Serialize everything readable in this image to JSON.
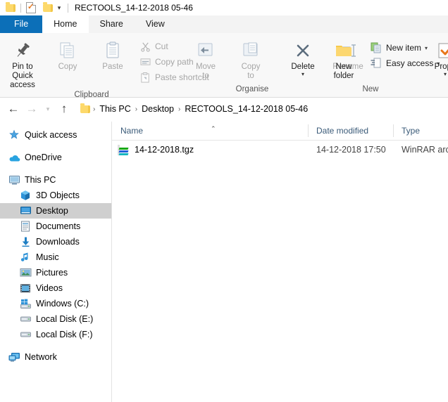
{
  "window": {
    "title": "RECTOOLS_14-12-2018 05-46",
    "quick_access_toolbar": [
      {
        "name": "folder-icon",
        "label": ""
      },
      {
        "name": "properties-icon",
        "label": ""
      },
      {
        "name": "new-folder-icon",
        "label": ""
      },
      {
        "name": "customize-qat-chevron-icon",
        "label": "▾"
      }
    ]
  },
  "tabs": [
    {
      "label": "File",
      "active": false,
      "is_file": true
    },
    {
      "label": "Home",
      "active": true,
      "is_file": false
    },
    {
      "label": "Share",
      "active": false,
      "is_file": false
    },
    {
      "label": "View",
      "active": false,
      "is_file": false
    }
  ],
  "ribbon": {
    "groups": [
      {
        "label": "Clipboard",
        "big_buttons": [
          {
            "label": "Pin to Quick\naccess",
            "icon": "pin-icon",
            "disabled": false
          },
          {
            "label": "Copy",
            "icon": "copy-icon",
            "disabled": true
          },
          {
            "label": "Paste",
            "icon": "paste-icon",
            "disabled": true
          }
        ],
        "small_buttons": [
          {
            "label": "Cut",
            "icon": "scissors-icon",
            "disabled": true
          },
          {
            "label": "Copy path",
            "icon": "copy-path-icon",
            "disabled": true
          },
          {
            "label": "Paste shortcut",
            "icon": "paste-shortcut-icon",
            "disabled": true
          }
        ]
      },
      {
        "label": "Organise",
        "big_buttons": [
          {
            "label": "Move\nto",
            "icon": "move-to-icon",
            "disabled": true,
            "caret": "▾"
          },
          {
            "label": "Copy\nto",
            "icon": "copy-to-icon",
            "disabled": true,
            "caret": "▾"
          },
          {
            "label": "Delete",
            "icon": "delete-x-icon",
            "disabled": false,
            "caret_below": "▾"
          },
          {
            "label": "Rename",
            "icon": "rename-icon",
            "disabled": true
          }
        ],
        "small_buttons": []
      },
      {
        "label": "New",
        "big_buttons": [
          {
            "label": "New\nfolder",
            "icon": "new-folder-icon",
            "disabled": false
          }
        ],
        "small_buttons": [
          {
            "label": "New item",
            "icon": "new-item-icon",
            "disabled": false,
            "caret": "▾"
          },
          {
            "label": "Easy access",
            "icon": "easy-access-icon",
            "disabled": false,
            "caret": "▾"
          }
        ]
      },
      {
        "label": "",
        "big_buttons": [
          {
            "label": "Prope",
            "icon": "properties-icon",
            "disabled": false,
            "caret_below": "▾"
          }
        ],
        "small_buttons": []
      }
    ]
  },
  "address_bar": {
    "back": "←",
    "forward": "→",
    "recent": "▾",
    "up": "↑",
    "breadcrumb": [
      "This PC",
      "Desktop",
      "RECTOOLS_14-12-2018 05-46"
    ],
    "separator": "›"
  },
  "sidebar": {
    "items": [
      {
        "label": "Quick access",
        "icon": "star-icon",
        "indent": false,
        "selected": false
      },
      {
        "label": "OneDrive",
        "icon": "cloud-icon",
        "indent": false,
        "selected": false,
        "gap_before": true
      },
      {
        "label": "This PC",
        "icon": "monitor-icon",
        "indent": false,
        "selected": false,
        "gap_before": true
      },
      {
        "label": "3D Objects",
        "icon": "3d-objects-icon",
        "indent": true,
        "selected": false
      },
      {
        "label": "Desktop",
        "icon": "desktop-icon",
        "indent": true,
        "selected": true
      },
      {
        "label": "Documents",
        "icon": "documents-icon",
        "indent": true,
        "selected": false
      },
      {
        "label": "Downloads",
        "icon": "downloads-icon",
        "indent": true,
        "selected": false
      },
      {
        "label": "Music",
        "icon": "music-icon",
        "indent": true,
        "selected": false
      },
      {
        "label": "Pictures",
        "icon": "pictures-icon",
        "indent": true,
        "selected": false
      },
      {
        "label": "Videos",
        "icon": "videos-icon",
        "indent": true,
        "selected": false
      },
      {
        "label": "Windows (C:)",
        "icon": "windows-drive-icon",
        "indent": true,
        "selected": false
      },
      {
        "label": "Local Disk (E:)",
        "icon": "drive-icon",
        "indent": true,
        "selected": false
      },
      {
        "label": "Local Disk (F:)",
        "icon": "drive-icon",
        "indent": true,
        "selected": false
      },
      {
        "label": "Network",
        "icon": "network-icon",
        "indent": false,
        "selected": false,
        "gap_before": true
      }
    ]
  },
  "file_list": {
    "columns": [
      {
        "label": "Name",
        "sorted": true,
        "sort_indicator": "⌃"
      },
      {
        "label": "Date modified",
        "sorted": false
      },
      {
        "label": "Type",
        "sorted": false
      }
    ],
    "rows": [
      {
        "name": "14-12-2018.tgz",
        "date_modified": "14-12-2018 17:50",
        "type": "WinRAR archiv",
        "icon": "winrar-archive-icon"
      }
    ]
  },
  "colors": {
    "file_tab_blue": "#0c6fb8",
    "ribbon_bg": "#f8f8f8",
    "tabstrip_bg": "#f3f3f3",
    "selection_gray": "#cfcfcf",
    "column_header_text": "#3a5a78",
    "folder_yellow": "#fdd96b",
    "accent_orange": "#e8761a"
  }
}
